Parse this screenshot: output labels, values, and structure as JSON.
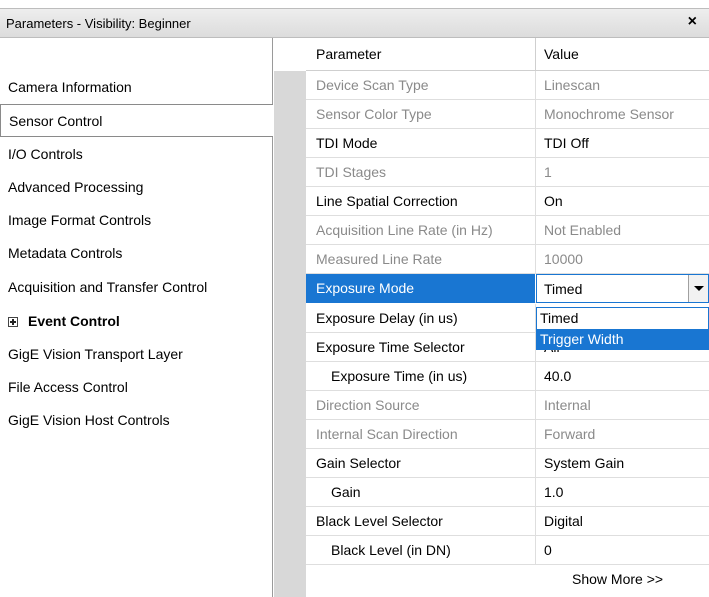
{
  "window": {
    "title": "Parameters - Visibility: Beginner",
    "close_glyph": "×"
  },
  "categories": [
    {
      "label": "Camera Information"
    },
    {
      "label": "Sensor Control",
      "selected": true
    },
    {
      "label": "I/O Controls"
    },
    {
      "label": "Advanced Processing"
    },
    {
      "label": "Image Format Controls"
    },
    {
      "label": "Metadata Controls"
    },
    {
      "label": "Acquisition and Transfer Control"
    },
    {
      "label": "Event Control",
      "expandable": true
    },
    {
      "label": "GigE Vision Transport Layer"
    },
    {
      "label": "File Access Control"
    },
    {
      "label": "GigE Vision Host Controls"
    }
  ],
  "grid": {
    "header": {
      "parameter": "Parameter",
      "value": "Value"
    },
    "rows": [
      {
        "name": "Device Scan Type",
        "value": "Linescan",
        "enabled": false
      },
      {
        "name": "Sensor Color Type",
        "value": "Monochrome Sensor",
        "enabled": false
      },
      {
        "name": "TDI Mode",
        "value": "TDI Off",
        "enabled": true
      },
      {
        "name": "TDI Stages",
        "value": "1",
        "enabled": false
      },
      {
        "name": "Line Spatial Correction",
        "value": "On",
        "enabled": true
      },
      {
        "name": "Acquisition Line Rate (in Hz)",
        "value": "Not Enabled",
        "enabled": false
      },
      {
        "name": "Measured Line Rate",
        "value": "10000",
        "enabled": false
      },
      {
        "name": "Exposure Mode",
        "value": "Timed",
        "enabled": true,
        "selected": true
      },
      {
        "name": "Exposure Delay (in us)",
        "value": "",
        "enabled": true
      },
      {
        "name": "Exposure Time Selector",
        "value": "All",
        "enabled": true
      },
      {
        "name": "Exposure Time (in us)",
        "value": "40.0",
        "enabled": true
      },
      {
        "name": "Direction Source",
        "value": "Internal",
        "enabled": false
      },
      {
        "name": "Internal Scan Direction",
        "value": "Forward",
        "enabled": false
      },
      {
        "name": "Gain Selector",
        "value": "System Gain",
        "enabled": true
      },
      {
        "name": "Gain",
        "value": "1.0",
        "enabled": true
      },
      {
        "name": "Black Level Selector",
        "value": "Digital",
        "enabled": true
      },
      {
        "name": "Black Level (in DN)",
        "value": "0",
        "enabled": true
      }
    ]
  },
  "dropdown": {
    "options": [
      "Timed",
      "Trigger Width"
    ],
    "highlighted": "Trigger Width"
  },
  "show_more_label": "Show More >>",
  "colors": {
    "accent": "#1976d2",
    "disabled_text": "#8a8a8a",
    "strip": "#d8d8d8"
  }
}
